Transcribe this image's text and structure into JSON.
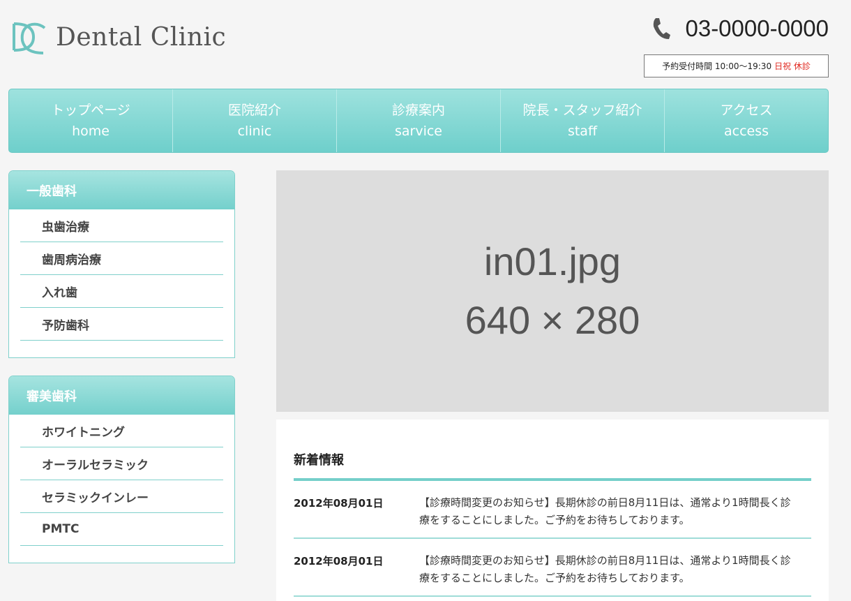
{
  "header": {
    "logo_text": "Dental Clinic",
    "phone": "03-0000-0000",
    "hours_label": "予約受付時間 10:00〜19:30",
    "closed_label": "日祝 休診"
  },
  "nav": [
    {
      "jp": "トップページ",
      "en": "home"
    },
    {
      "jp": "医院紹介",
      "en": "clinic"
    },
    {
      "jp": "診療案内",
      "en": "sarvice"
    },
    {
      "jp": "院長・スタッフ紹介",
      "en": "staff"
    },
    {
      "jp": "アクセス",
      "en": "access"
    }
  ],
  "sidebar": {
    "general": {
      "title": "一般歯科",
      "items": [
        "虫歯治療",
        "歯周病治療",
        "入れ歯",
        "予防歯科"
      ]
    },
    "cosmetic": {
      "title": "審美歯科",
      "items": [
        "ホワイトニング",
        "オーラルセラミック",
        "セラミックインレー",
        "PMTC"
      ]
    }
  },
  "hero": {
    "line1": "in01.jpg",
    "line2": "640 × 280"
  },
  "news": {
    "title": "新着情報",
    "items": [
      {
        "date": "2012年08月01日",
        "text": "【診療時間変更のお知らせ】長期休診の前日8月11日は、通常より1時間長く診療をすることにしました。ご予約をお待ちしております。"
      },
      {
        "date": "2012年08月01日",
        "text": "【診療時間変更のお知らせ】長期休診の前日8月11日は、通常より1時間長く診療をすることにしました。ご予約をお待ちしております。"
      }
    ]
  },
  "colors": {
    "accent": "#75cfca",
    "closed": "#e0281f",
    "placeholder_bg": "#dddddd"
  }
}
